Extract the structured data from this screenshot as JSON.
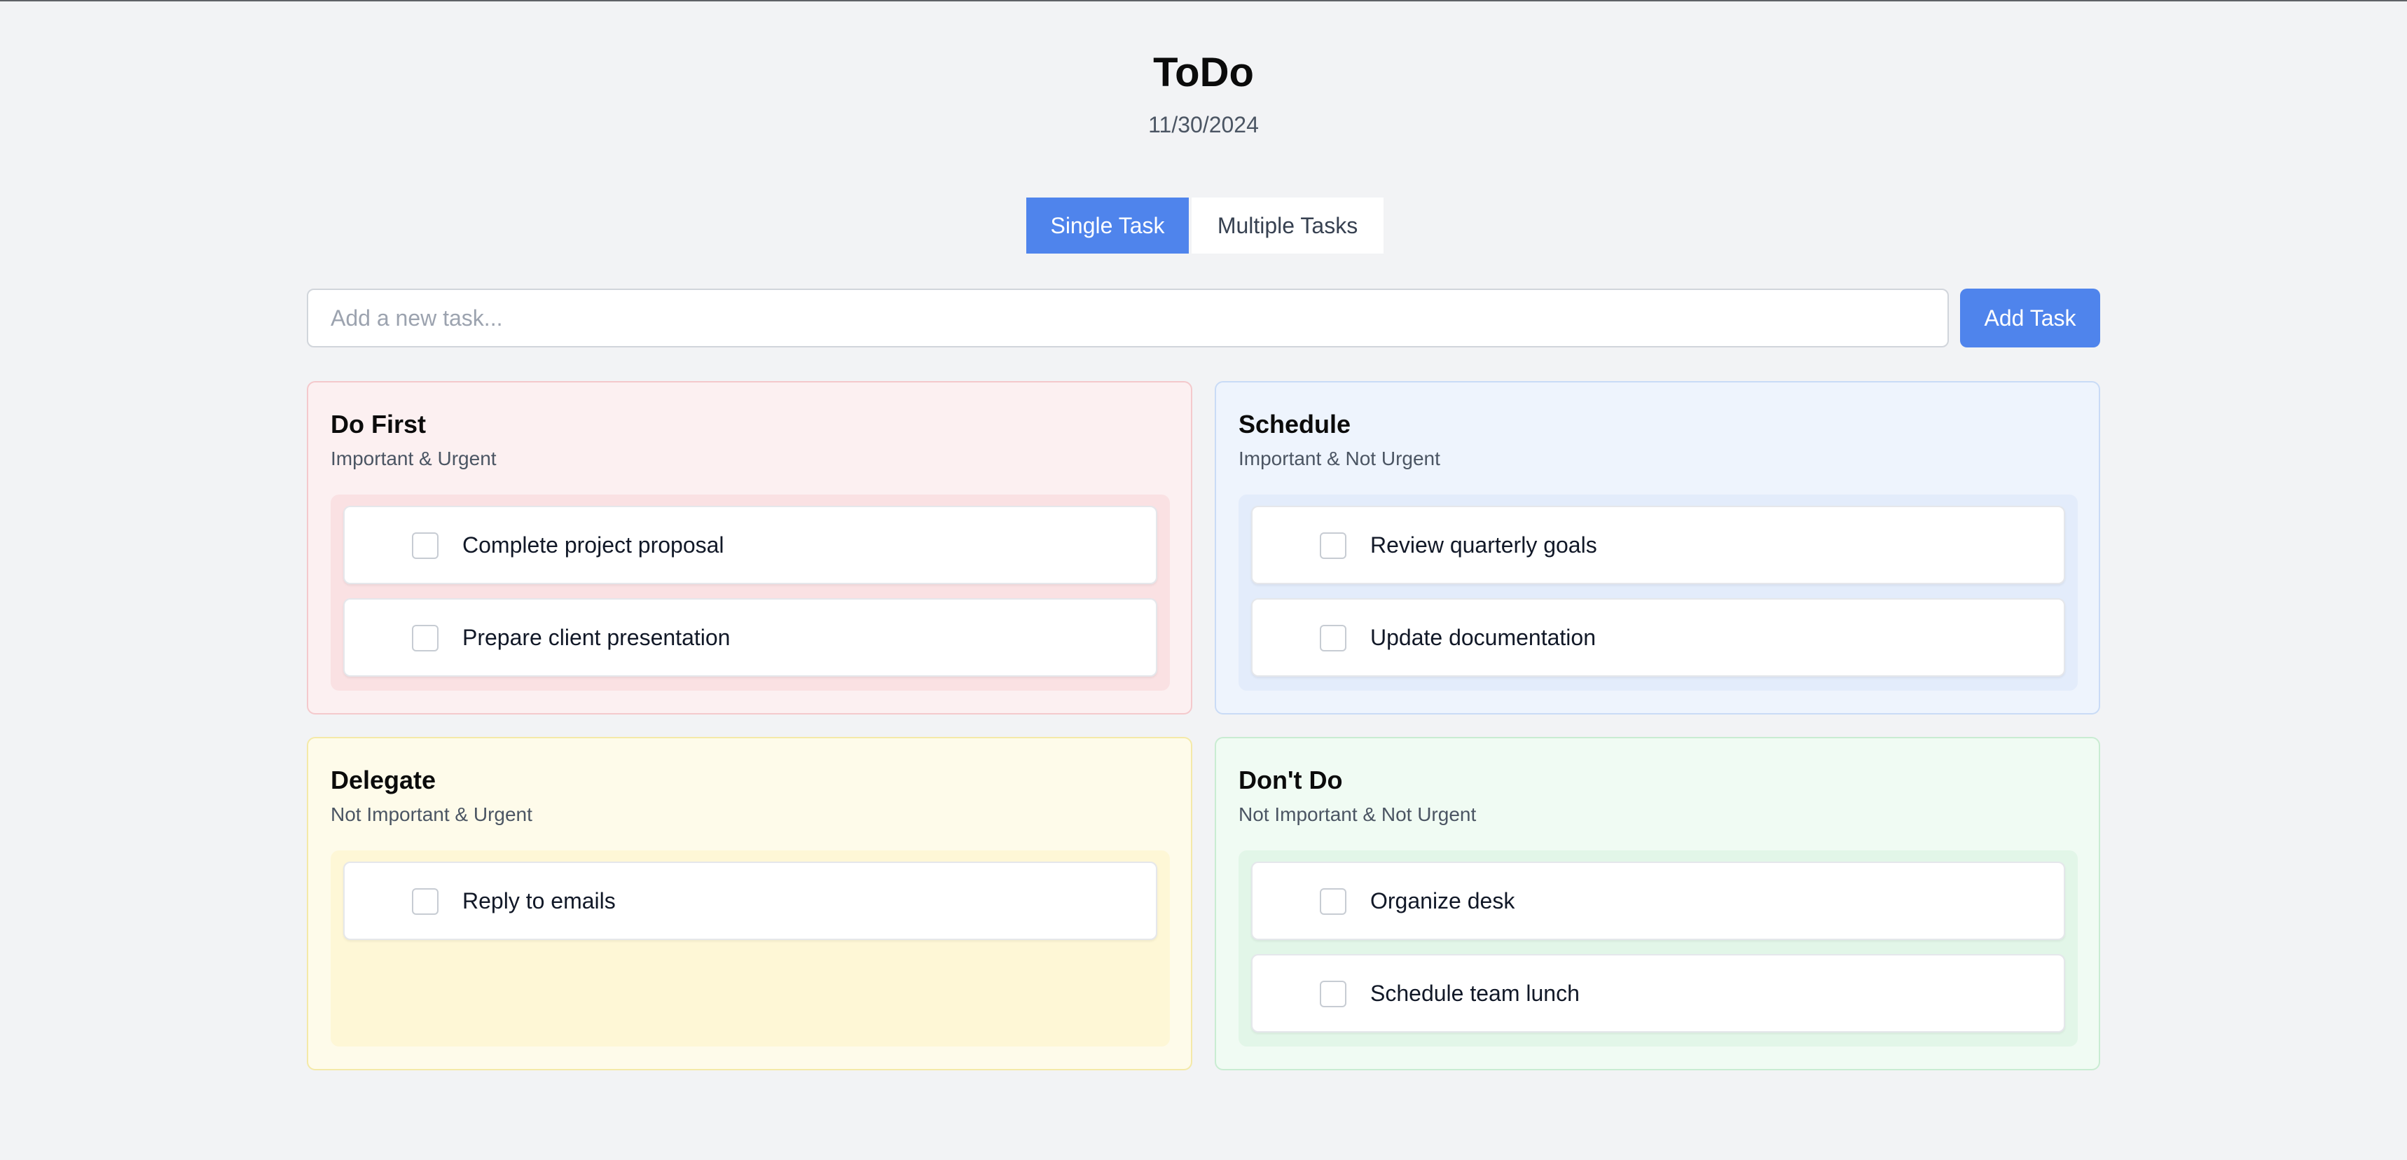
{
  "app": {
    "title": "ToDo",
    "date": "11/30/2024"
  },
  "mode_toggle": {
    "single_label": "Single Task",
    "multiple_label": "Multiple Tasks",
    "selected": "Single Task"
  },
  "add_task": {
    "placeholder": "Add a new task...",
    "value": "",
    "button_label": "Add Task"
  },
  "colors": {
    "accent": "#4f84ec",
    "do_first_bg": "#fcf0f1",
    "schedule_bg": "#eef4fd",
    "delegate_bg": "#fefbea",
    "dont_do_bg": "#f0fbf3"
  },
  "quadrants": [
    {
      "title": "Do First",
      "subtitle": "Important & Urgent",
      "tasks": [
        {
          "text": "Complete project proposal",
          "done": false
        },
        {
          "text": "Prepare client presentation",
          "done": false
        }
      ]
    },
    {
      "title": "Schedule",
      "subtitle": "Important & Not Urgent",
      "tasks": [
        {
          "text": "Review quarterly goals",
          "done": false
        },
        {
          "text": "Update documentation",
          "done": false
        }
      ]
    },
    {
      "title": "Delegate",
      "subtitle": "Not Important & Urgent",
      "tasks": [
        {
          "text": "Reply to emails",
          "done": false
        }
      ]
    },
    {
      "title": "Don't Do",
      "subtitle": "Not Important & Not Urgent",
      "tasks": [
        {
          "text": "Organize desk",
          "done": false
        },
        {
          "text": "Schedule team lunch",
          "done": false
        }
      ]
    }
  ]
}
